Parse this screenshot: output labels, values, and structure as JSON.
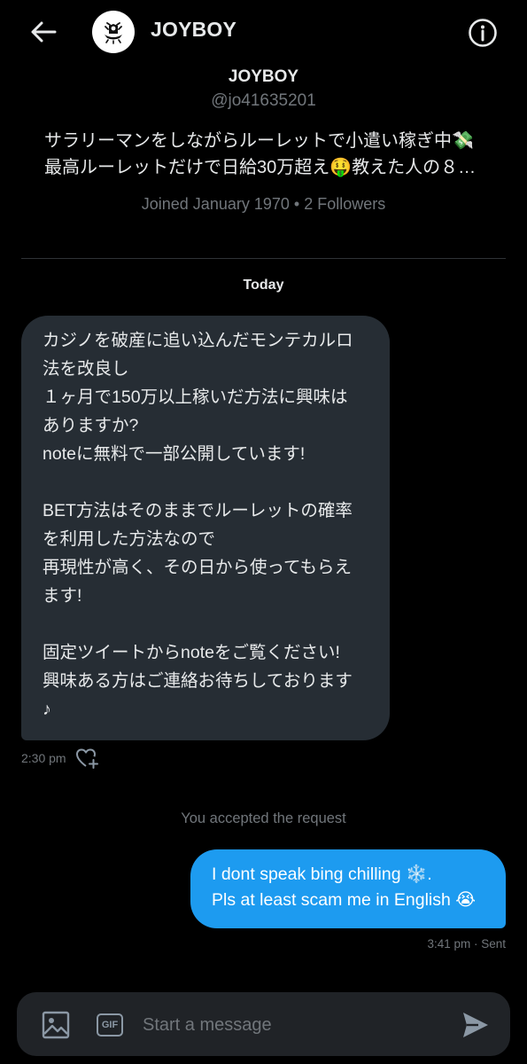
{
  "colors": {
    "background": "#000000",
    "incoming_bubble": "#262d34",
    "outgoing_bubble": "#1d9bf0",
    "primary_text": "#e7e9ea",
    "secondary_text": "#71767b",
    "composer_bg": "#202327"
  },
  "header": {
    "title": "JOYBOY",
    "back_icon": "arrow-left-icon",
    "info_icon": "info-circle-icon"
  },
  "profile": {
    "name": "JOYBOY",
    "handle": "@jo41635201",
    "bio_lines": [
      "サラリーマンをしながらルーレットで小遣い稼ぎ中💸",
      "最高ルーレットだけで日給30万超え🤑教えた人の８…"
    ],
    "meta": "Joined January 1970 • 2 Followers"
  },
  "conversation": {
    "date_label": "Today",
    "incoming": {
      "lines": [
        "カジノを破産に追い込んだモンテカルロ",
        "法を改良し",
        "１ヶ月で150万以上稼いだ方法に興味は",
        "ありますか?",
        "noteに無料で一部公開しています!",
        "",
        "BET方法はそのままでルーレットの確率",
        "を利用した方法なので",
        "再現性が高く、その日から使ってもらえ",
        "ます!",
        "",
        "固定ツイートからnoteをご覧ください!",
        "興味ある方はご連絡お待ちしております",
        "♪"
      ],
      "time": "2:30 pm"
    },
    "system_note": "You accepted the request",
    "outgoing": {
      "lines": [
        "I dont speak bing chilling ❄️.",
        "Pls at least scam me in English 😭"
      ],
      "status": "3:41 pm · Sent"
    }
  },
  "composer": {
    "placeholder": "Start a message",
    "value": "",
    "gif_label": "GIF"
  }
}
